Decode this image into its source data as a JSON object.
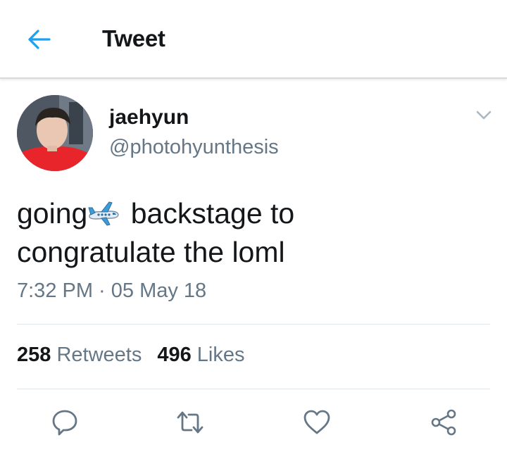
{
  "header": {
    "title": "Tweet",
    "back_icon": "arrow-left-icon"
  },
  "tweet": {
    "display_name": "jaehyun",
    "handle": "@photohyunthesis",
    "text_line1_before": "going",
    "text_line1_after": " backstage to",
    "text_line2": "congratulate the loml",
    "emoji": "airplane-icon",
    "timestamp": "7:32 PM · 05 May 18",
    "retweets_count": "258",
    "retweets_label": "Retweets",
    "likes_count": "496",
    "likes_label": "Likes"
  },
  "actions": [
    "reply-icon",
    "retweet-icon",
    "like-icon",
    "share-icon"
  ],
  "colors": {
    "accent": "#1da1f2",
    "text_primary": "#14171a",
    "text_secondary": "#657786",
    "divider": "#dfe4e8",
    "icon_gray": "#657786"
  }
}
